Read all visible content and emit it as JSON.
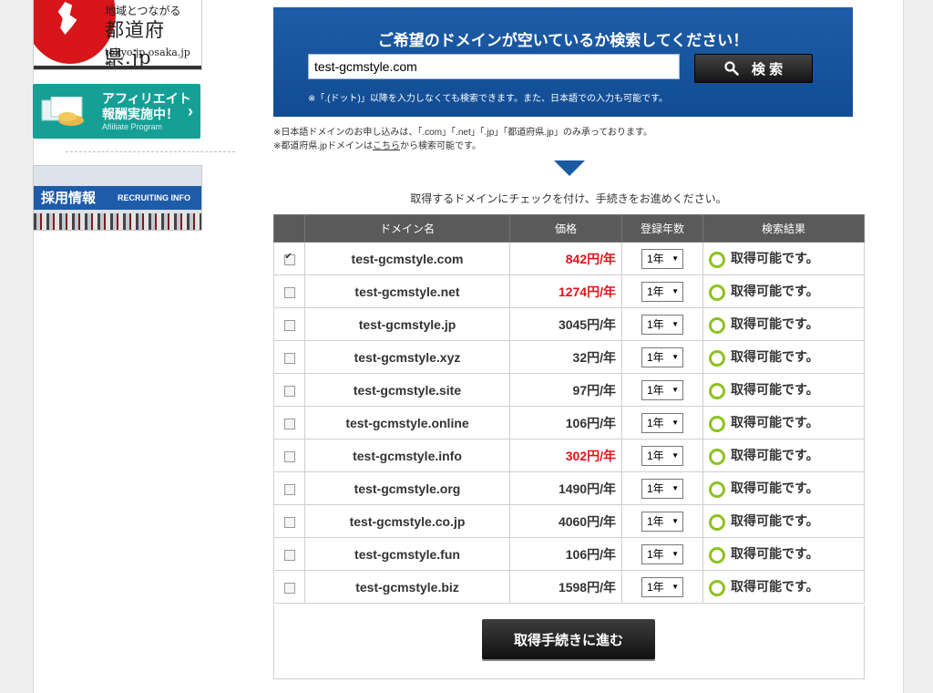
{
  "sidebar": {
    "pref_banner": {
      "line1": "地域とつながる",
      "line2": "都道府県.jp",
      "line3": "tokyo.jp osaka.jp 等"
    },
    "affiliate_banner": {
      "line1": "アフィリエイト",
      "line2": "報酬実施中！",
      "line3": "Afiiliate Program",
      "arrow": "›"
    },
    "recruit_banner": {
      "title": "採用情報",
      "subtitle": "RECRUITING INFO"
    }
  },
  "search": {
    "title": "ご希望のドメインが空いているか検索してください！",
    "input_value": "test-gcmstyle.com",
    "button_label": "検 索",
    "note": "※「.(ドット)」以降を入力しなくても検索できます。また、日本語での入力も可能です。"
  },
  "notes": {
    "line1": "※日本語ドメインのお申し込みは、「.com」「.net」「.jp」「都道府県.jp」のみ承っております。",
    "line2_pre": "※都道府県.jpドメインは",
    "line2_link": "こちら",
    "line2_post": "から検索可能です。"
  },
  "instruction": "取得するドメインにチェックを付け、手続きをお進めください。",
  "table": {
    "headers": {
      "check": "",
      "name": "ドメイン名",
      "price": "価格",
      "years": "登録年数",
      "result": "検索結果"
    },
    "rows": [
      {
        "checked": true,
        "name": "test-gcmstyle.com",
        "price": "842円/年",
        "price_red": true,
        "years": "1年",
        "result": "取得可能です。"
      },
      {
        "checked": false,
        "name": "test-gcmstyle.net",
        "price": "1274円/年",
        "price_red": true,
        "years": "1年",
        "result": "取得可能です。"
      },
      {
        "checked": false,
        "name": "test-gcmstyle.jp",
        "price": "3045円/年",
        "price_red": false,
        "years": "1年",
        "result": "取得可能です。"
      },
      {
        "checked": false,
        "name": "test-gcmstyle.xyz",
        "price": "32円/年",
        "price_red": false,
        "years": "1年",
        "result": "取得可能です。"
      },
      {
        "checked": false,
        "name": "test-gcmstyle.site",
        "price": "97円/年",
        "price_red": false,
        "years": "1年",
        "result": "取得可能です。"
      },
      {
        "checked": false,
        "name": "test-gcmstyle.online",
        "price": "106円/年",
        "price_red": false,
        "years": "1年",
        "result": "取得可能です。"
      },
      {
        "checked": false,
        "name": "test-gcmstyle.info",
        "price": "302円/年",
        "price_red": true,
        "years": "1年",
        "result": "取得可能です。"
      },
      {
        "checked": false,
        "name": "test-gcmstyle.org",
        "price": "1490円/年",
        "price_red": false,
        "years": "1年",
        "result": "取得可能です。"
      },
      {
        "checked": false,
        "name": "test-gcmstyle.co.jp",
        "price": "4060円/年",
        "price_red": false,
        "years": "1年",
        "result": "取得可能です。"
      },
      {
        "checked": false,
        "name": "test-gcmstyle.fun",
        "price": "106円/年",
        "price_red": false,
        "years": "1年",
        "result": "取得可能です。"
      },
      {
        "checked": false,
        "name": "test-gcmstyle.biz",
        "price": "1598円/年",
        "price_red": false,
        "years": "1年",
        "result": "取得可能です。"
      }
    ]
  },
  "proceed_button": "取得手続きに進む",
  "icons": {
    "search": "search-icon",
    "select_arrow": "▼",
    "available": "circle-icon"
  },
  "colors": {
    "header_blue": "#1f5da8",
    "price_red": "#e0141a",
    "available_green": "#8dc21f",
    "table_header": "#5a5a5a"
  }
}
